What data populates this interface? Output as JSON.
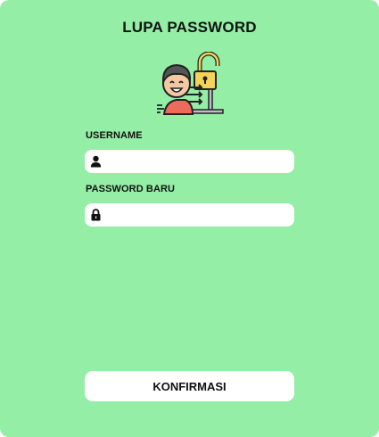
{
  "page": {
    "title": "LUPA PASSWORD",
    "illustration_icon": "forgot-password-person-unlock"
  },
  "form": {
    "username": {
      "label": "USERNAME",
      "value": "",
      "placeholder": "",
      "icon": "user-icon"
    },
    "new_password": {
      "label": "PASSWORD BARU",
      "value": "",
      "placeholder": "",
      "icon": "lock-icon"
    },
    "confirm_label": "KONFIRMASI"
  },
  "colors": {
    "background": "#94eea6",
    "input_background": "#ffffff",
    "text": "#111111"
  }
}
